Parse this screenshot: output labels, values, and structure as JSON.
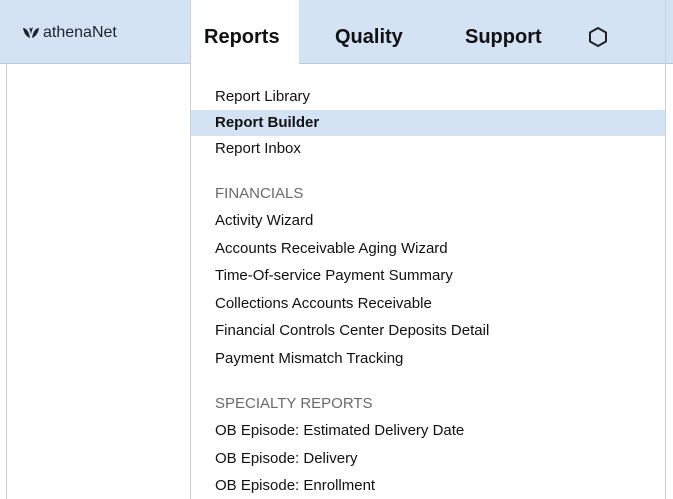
{
  "app": {
    "logo_text": "athenaNet"
  },
  "nav": {
    "tabs": [
      "Reports",
      "Quality",
      "Support"
    ],
    "active_tab": "Reports"
  },
  "menu": {
    "top_items": [
      "Report Library",
      "Report Builder",
      "Report Inbox"
    ],
    "selected_item": "Report Builder",
    "financials": {
      "heading": "FINANCIALS",
      "items": [
        "Activity Wizard",
        "Accounts Receivable Aging Wizard",
        "Time-Of-service Payment Summary",
        "Collections Accounts Receivable",
        "Financial Controls Center Deposits Detail",
        "Payment Mismatch Tracking"
      ]
    },
    "specialty": {
      "heading": "SPECIALTY REPORTS",
      "items": [
        "OB Episode: Estimated Delivery Date",
        "OB Episode: Delivery",
        "OB Episode: Enrollment"
      ]
    }
  },
  "colors": {
    "topbar": "#d3e3f4",
    "selected_row": "#d3e3f4",
    "heading_text": "#6a6a6a"
  },
  "icons": {
    "logo": "leaf-logo-icon",
    "settings": "gear-icon"
  }
}
